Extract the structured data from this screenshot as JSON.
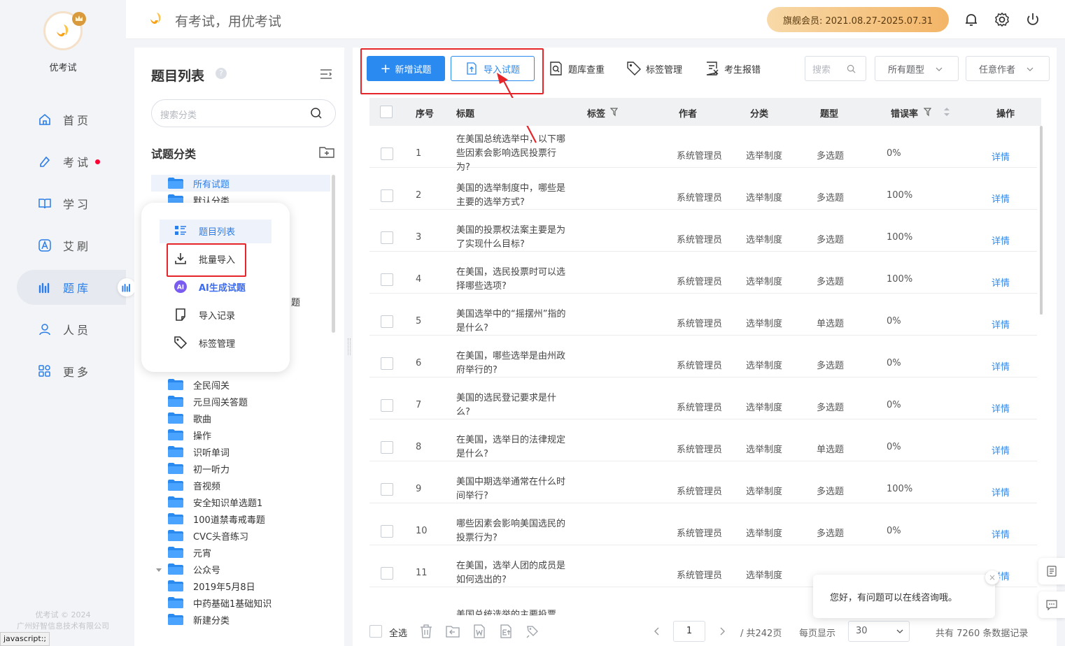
{
  "app": {
    "name": "优考试",
    "slogan": "有考试，用优考试",
    "vip": "旗舰会员: 2021.08.27-2025.07.31",
    "footer_line1": "优考试 © 2024",
    "footer_line2": "广州好智信息技术有限公司",
    "status": "javascript:;"
  },
  "nav": {
    "items": [
      {
        "label": "首页",
        "icon": "home-icon"
      },
      {
        "label": "考试",
        "icon": "exam-icon"
      },
      {
        "label": "学习",
        "icon": "book-icon"
      },
      {
        "label": "艾刷",
        "icon": "a-icon"
      },
      {
        "label": "题库",
        "icon": "chart-icon"
      },
      {
        "label": "人员",
        "icon": "person-icon"
      },
      {
        "label": "更多",
        "icon": "grid-icon"
      }
    ]
  },
  "category": {
    "title": "题目列表",
    "search_placeholder": "搜索分类",
    "subtitle": "试题分类",
    "tree_top": [
      "所有试题",
      "默认分类"
    ],
    "tree_partial": "题",
    "tree": [
      "全民闯关",
      "元旦闯关答题",
      "歌曲",
      "操作",
      "识听单词",
      "初一听力",
      "音视频",
      "安全知识单选题1",
      "100道禁毒戒毒题",
      "CVC头音练习",
      "元宵",
      "公众号",
      "2019年5月8日",
      "中药基础1基础知识",
      "新建分类"
    ]
  },
  "popup": {
    "items": [
      "题目列表",
      "批量导入",
      "AI生成试题",
      "导入记录",
      "标签管理"
    ]
  },
  "toolbar": {
    "add": "新增试题",
    "import": "导入试题",
    "dedup": "题库查重",
    "tags": "标签管理",
    "report": "考生报错",
    "search_placeholder": "搜索",
    "type_filter": "所有题型",
    "author_filter": "任意作者"
  },
  "table": {
    "headers": {
      "no": "序号",
      "title": "标题",
      "tag": "标签",
      "author": "作者",
      "category": "分类",
      "type": "题型",
      "error": "错误率",
      "action": "操作"
    },
    "rows": [
      {
        "no": "1",
        "title": "在美国总统选举中，以下哪些因素会影响选民投票行为?",
        "author": "系统管理员",
        "category": "选举制度",
        "type": "多选题",
        "error": "0%",
        "action": "详情"
      },
      {
        "no": "2",
        "title": "美国的选举制度中，哪些是主要的选举方式?",
        "author": "系统管理员",
        "category": "选举制度",
        "type": "多选题",
        "error": "100%",
        "action": "详情"
      },
      {
        "no": "3",
        "title": "美国的投票权法案主要是为了实现什么目标?",
        "author": "系统管理员",
        "category": "选举制度",
        "type": "多选题",
        "error": "100%",
        "action": "详情"
      },
      {
        "no": "4",
        "title": "在美国，选民投票时可以选择哪些选项?",
        "author": "系统管理员",
        "category": "选举制度",
        "type": "多选题",
        "error": "100%",
        "action": "详情"
      },
      {
        "no": "5",
        "title": "美国选举中的“摇摆州”指的是什么?",
        "author": "系统管理员",
        "category": "选举制度",
        "type": "单选题",
        "error": "0%",
        "action": "详情"
      },
      {
        "no": "6",
        "title": "在美国，哪些选举是由州政府举行的?",
        "author": "系统管理员",
        "category": "选举制度",
        "type": "多选题",
        "error": "0%",
        "action": "详情"
      },
      {
        "no": "7",
        "title": "美国的选民登记要求是什么?",
        "author": "系统管理员",
        "category": "选举制度",
        "type": "多选题",
        "error": "0%",
        "action": "详情"
      },
      {
        "no": "8",
        "title": "在美国，选举日的法律规定是什么?",
        "author": "系统管理员",
        "category": "选举制度",
        "type": "单选题",
        "error": "0%",
        "action": "详情"
      },
      {
        "no": "9",
        "title": "美国中期选举通常在什么时间举行?",
        "author": "系统管理员",
        "category": "选举制度",
        "type": "多选题",
        "error": "100%",
        "action": "详情"
      },
      {
        "no": "10",
        "title": "哪些因素会影响美国选民的投票行为?",
        "author": "系统管理员",
        "category": "选举制度",
        "type": "多选题",
        "error": "0%",
        "action": "详情"
      },
      {
        "no": "11",
        "title": "在美国，选举人团的成员是如何选出的?",
        "author": "系统管理员",
        "category": "选举制度",
        "type": "",
        "error": "",
        "action": "详情"
      }
    ],
    "partial_row": "美国总统选举的主要投票"
  },
  "footer": {
    "select_all": "全选",
    "page": "1",
    "total_pages": "/ 共242页",
    "per_page_label": "每页显示",
    "per_page": "30",
    "total": "共有 7260 条数据记录"
  },
  "chat": {
    "message": "您好，有问题可以在线咨询哦。",
    "close": "×"
  }
}
